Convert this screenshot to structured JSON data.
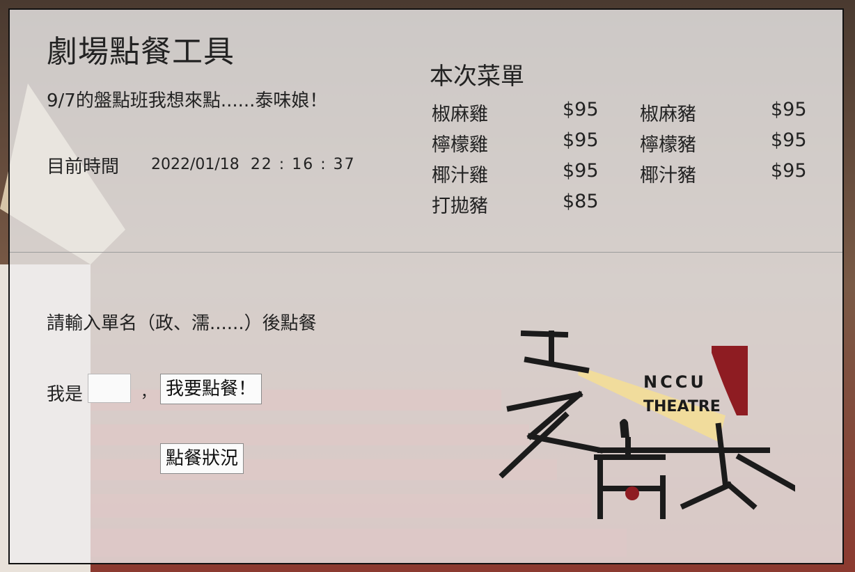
{
  "app": {
    "title": "劇場點餐工具",
    "subtitle": "9/7的盤點班我想來點......泰味娘！"
  },
  "clock": {
    "label": "目前時間",
    "date": "2022/01/18",
    "time": "22 : 16 : 37"
  },
  "menu": {
    "title": "本次菜單",
    "items": [
      {
        "name": "椒麻雞",
        "price": "$95"
      },
      {
        "name": "檸檬雞",
        "price": "$95"
      },
      {
        "name": "椰汁雞",
        "price": "$95"
      },
      {
        "name": "打拋豬",
        "price": "$85"
      },
      {
        "name": "椒麻豬",
        "price": "$95"
      },
      {
        "name": "檸檬豬",
        "price": "$95"
      },
      {
        "name": "椰汁豬",
        "price": "$95"
      }
    ]
  },
  "order": {
    "instruction": "請輸入單名（政、濡......）後點餐",
    "iam_label": "我是",
    "name_value": "",
    "comma": "，",
    "order_button": "我要點餐！",
    "status_button": "點餐狀況"
  },
  "logo": {
    "text_line1": "NCCU",
    "text_line2": "THEATRE",
    "icon": "nccu-theatre-logo"
  },
  "colors": {
    "panel": "#eeecec",
    "logo_red": "#8e1c22",
    "logo_beam": "#f1dc9c",
    "logo_ink": "#1b1b1b"
  }
}
